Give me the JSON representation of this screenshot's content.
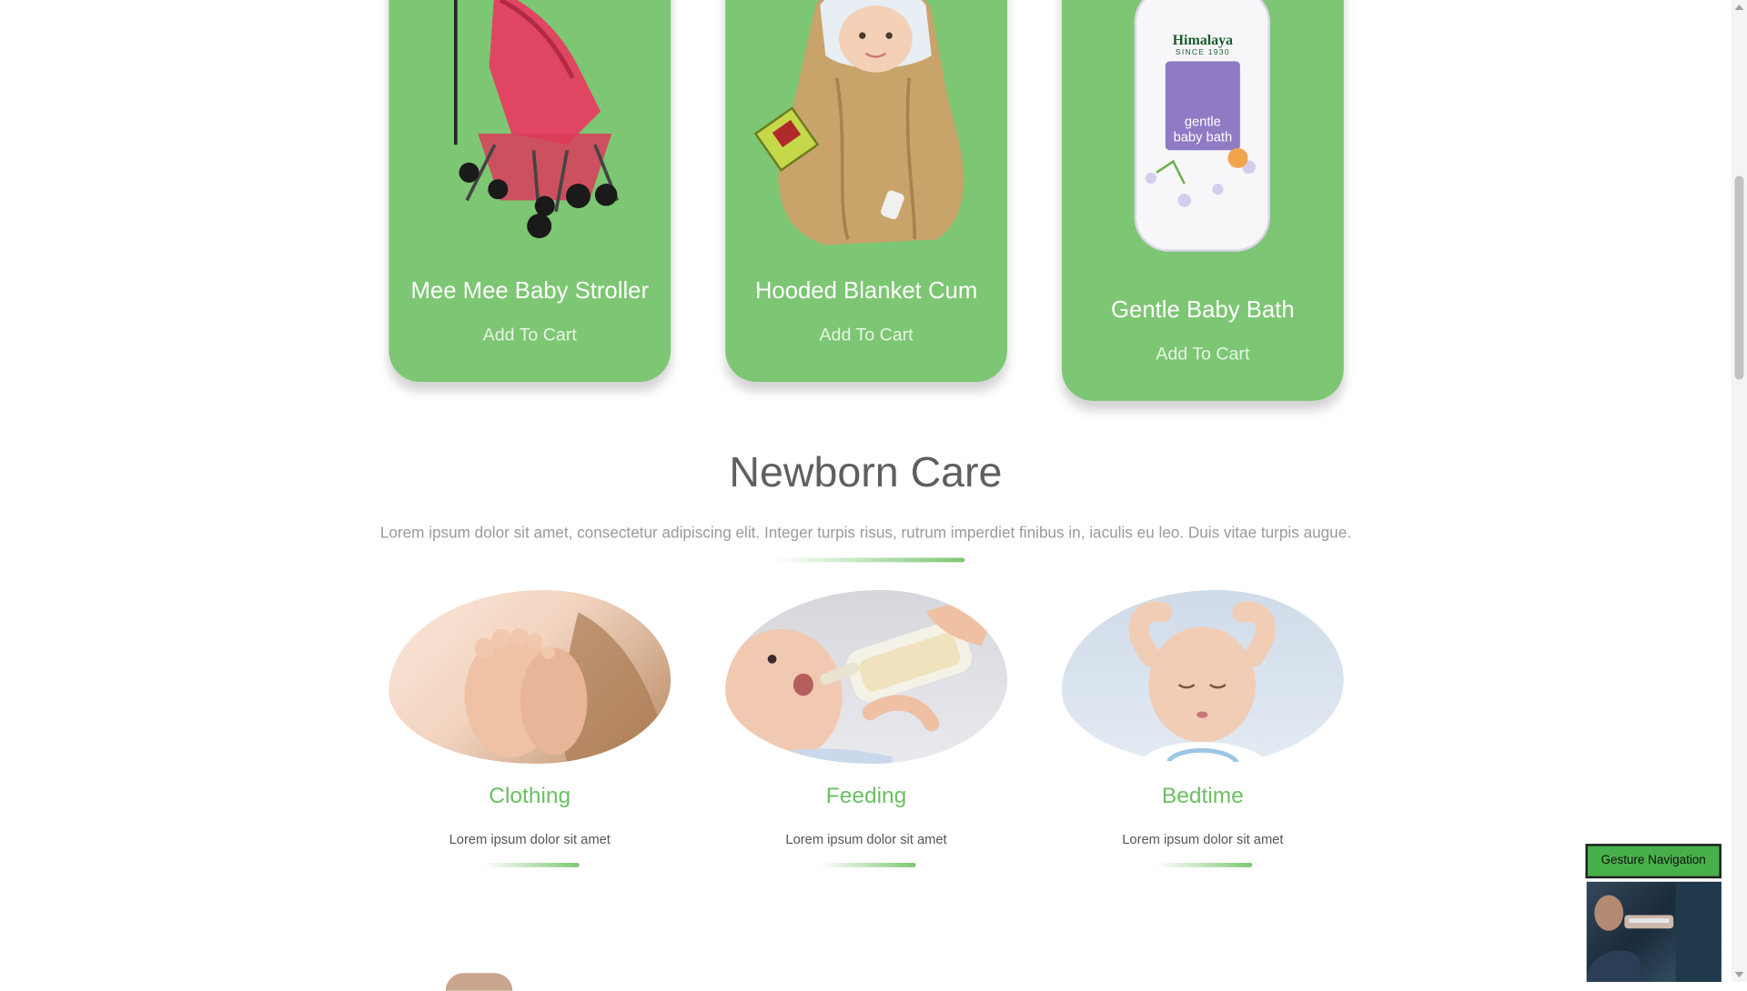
{
  "products": [
    {
      "name": "Mee Mee Baby Stroller",
      "cta": "Add To Cart",
      "image_icon": "baby-stroller-icon"
    },
    {
      "name": "Hooded Blanket Cum",
      "cta": "Add To Cart",
      "image_icon": "hooded-blanket-icon"
    },
    {
      "name": "Gentle Baby Bath",
      "cta": "Add To Cart",
      "image_icon": "baby-bath-bottle-icon",
      "bottle": {
        "brand": "Himalaya",
        "since": "SINCE 1930",
        "line1": "gentle",
        "line2": "baby bath"
      }
    }
  ],
  "section": {
    "title": "Newborn Care",
    "description": "Lorem ipsum dolor sit amet, consectetur adipiscing elit. Integer turpis risus, rutrum imperdiet finibus in, iaculis eu leo. Duis vitae turpis augue."
  },
  "categories": [
    {
      "name": "Clothing",
      "desc": "Lorem ipsum dolor sit amet",
      "image_icon": "baby-feet-icon"
    },
    {
      "name": "Feeding",
      "desc": "Lorem ipsum dolor sit amet",
      "image_icon": "baby-feeding-bottle-icon"
    },
    {
      "name": "Bedtime",
      "desc": "Lorem ipsum dolor sit amet",
      "image_icon": "sleeping-baby-icon"
    }
  ],
  "gesture_widget": {
    "label": "Gesture Navigation"
  },
  "colors": {
    "accent": "#7dc673",
    "accent_text": "#6bbf63",
    "title_text": "#5f5f5f",
    "muted_text": "#9a9a9a"
  }
}
